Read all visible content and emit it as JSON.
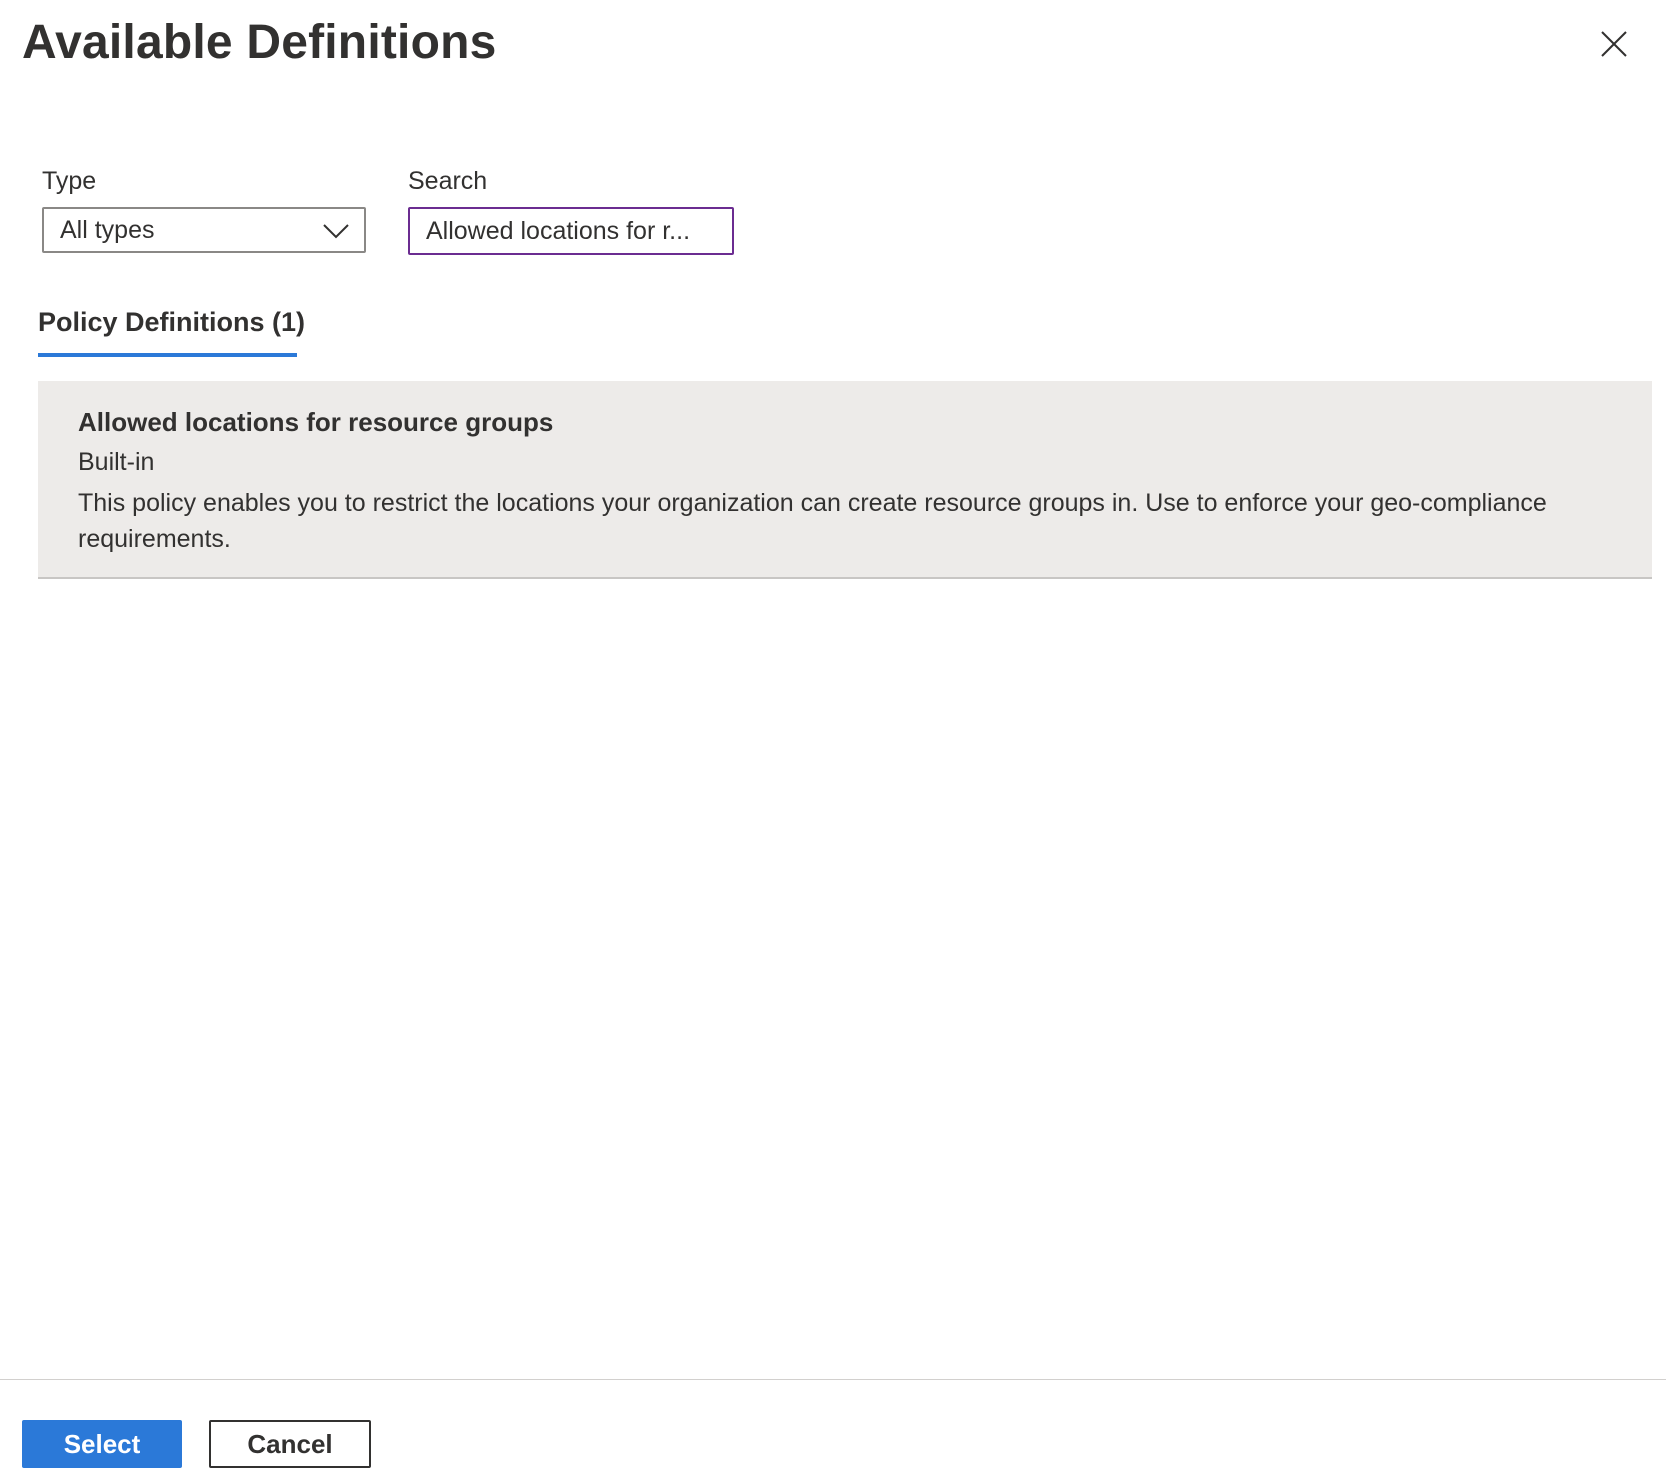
{
  "panel": {
    "title": "Available Definitions",
    "close_icon": "close-icon"
  },
  "filters": {
    "type_label": "Type",
    "type_value": "All types",
    "type_icon": "chevron-down-icon",
    "search_label": "Search",
    "search_value": "Allowed locations for r..."
  },
  "tabs": [
    {
      "label": "Policy Definitions (1)",
      "selected": true
    }
  ],
  "results": [
    {
      "name": "Allowed locations for resource groups",
      "type": "Built-in",
      "description": "This policy enables you to restrict the locations your organization can create resource groups in. Use to enforce your geo-compliance requirements."
    }
  ],
  "footer": {
    "select_label": "Select",
    "cancel_label": "Cancel"
  },
  "colors": {
    "accent": "#2b79d8",
    "search_focus_border": "#6b2c91",
    "result_selected_bg": "#edebe9",
    "text": "#323130"
  }
}
